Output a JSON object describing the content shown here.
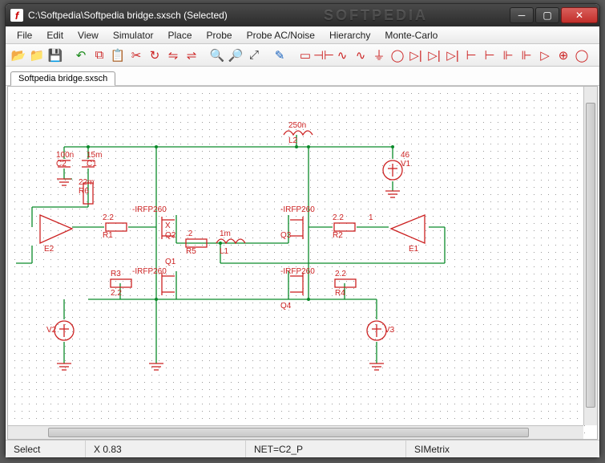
{
  "title": "C:\\Softpedia\\Softpedia bridge.sxsch (Selected)",
  "watermark": "SOFTPEDIA",
  "menu": [
    "File",
    "Edit",
    "View",
    "Simulator",
    "Place",
    "Probe",
    "Probe AC/Noise",
    "Hierarchy",
    "Monte-Carlo"
  ],
  "tab": "Softpedia bridge.sxsch",
  "status": {
    "mode": "Select",
    "x": "X  0.83",
    "net": "NET=C2_P",
    "brand": "SIMetrix"
  },
  "toolbar_icons": [
    "folder-open-icon",
    "folder-icon",
    "save-icon",
    "sep",
    "undo-icon",
    "copy-icon",
    "paste-icon",
    "cut-icon",
    "rotate-icon",
    "flip-icon",
    "mirror-icon",
    "sep",
    "zoom-in-icon",
    "zoom-out-icon",
    "zoom-fit-icon",
    "sep",
    "pencil-icon",
    "sep",
    "resistor-icon",
    "capacitor-icon",
    "inductor-icon",
    "sine-icon",
    "ground-icon",
    "current-icon",
    "diode-icon",
    "zener-icon",
    "led-icon",
    "npn-icon",
    "pnp-icon",
    "nmos-icon",
    "pmos-icon",
    "opamp-icon",
    "vsource-icon",
    "isource-icon"
  ],
  "components": {
    "C2": {
      "ref": "C2",
      "val": "100n"
    },
    "C1": {
      "ref": "C1",
      "val": "15m"
    },
    "R6": {
      "ref": "R6",
      "val": "22m"
    },
    "R1": {
      "ref": "R1",
      "val": "2.2"
    },
    "R2": {
      "ref": "R2",
      "val": "2.2"
    },
    "R3": {
      "ref": "R3",
      "val": "2.2"
    },
    "R4": {
      "ref": "R4",
      "val": "2.2"
    },
    "R5": {
      "ref": "R5",
      "val": ".2"
    },
    "L1": {
      "ref": "L1",
      "val": "1m"
    },
    "L2": {
      "ref": "L2",
      "val": "250n"
    },
    "V1": {
      "ref": "V1",
      "val": "46"
    },
    "V2": {
      "ref": "V2"
    },
    "V3": {
      "ref": "V3"
    },
    "E1": {
      "ref": "E1",
      "val": "1"
    },
    "E2": {
      "ref": "E2"
    },
    "Q1": {
      "ref": "Q1",
      "model": "-IRFP260"
    },
    "Q2": {
      "ref": "Q2",
      "model": "-IRFP260"
    },
    "Q3": {
      "ref": "Q3",
      "model": "-IRFP260"
    },
    "Q4": {
      "ref": "Q4",
      "model": "-IRFP260"
    }
  }
}
